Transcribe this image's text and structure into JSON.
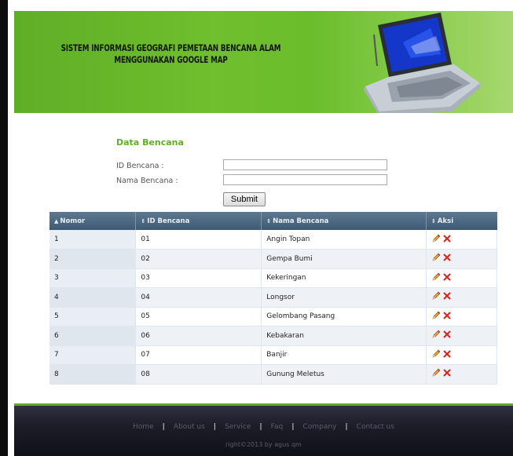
{
  "header": {
    "title_line1": "SISTEM INFORMASI GEOGRAFI PEMETAAN BENCANA ALAM",
    "title_line2": "MENGGUNAKAN GOOGLE MAP"
  },
  "form": {
    "title": "Data Bencana",
    "id_label": "ID Bencana :",
    "id_value": "",
    "name_label": "Nama Bencana :",
    "name_value": "",
    "submit_label": "Submit"
  },
  "table": {
    "columns": [
      "Nomor",
      "ID Bencana",
      "Nama Bencana",
      "Aksi"
    ],
    "column_sort_glyphs": [
      "▲",
      "⇕",
      "⇕",
      "⇕"
    ],
    "rows": [
      {
        "nomor": "1",
        "id": "01",
        "nama": "Angin Topan"
      },
      {
        "nomor": "2",
        "id": "02",
        "nama": "Gempa Bumi"
      },
      {
        "nomor": "3",
        "id": "03",
        "nama": "Kekeringan"
      },
      {
        "nomor": "4",
        "id": "04",
        "nama": "Longsor"
      },
      {
        "nomor": "5",
        "id": "05",
        "nama": "Gelombang Pasang"
      },
      {
        "nomor": "6",
        "id": "06",
        "nama": "Kebakaran"
      },
      {
        "nomor": "7",
        "id": "07",
        "nama": "Banjir"
      },
      {
        "nomor": "8",
        "id": "08",
        "nama": "Gunung Meletus"
      }
    ],
    "action_icons": [
      "pencil-edit-icon",
      "red-x-delete-icon"
    ]
  },
  "footer": {
    "nav": [
      "Home",
      "About us",
      "Service",
      "Faq",
      "Company",
      "Contact us"
    ],
    "separator": "|",
    "copyright": "right©2013 by agus qm"
  },
  "colors": {
    "header_green": "#6fbf2e",
    "title_green": "#5fae26",
    "table_header": "#4b667f",
    "footer_dark": "#1c1d28",
    "delete_red": "#e0201b"
  }
}
